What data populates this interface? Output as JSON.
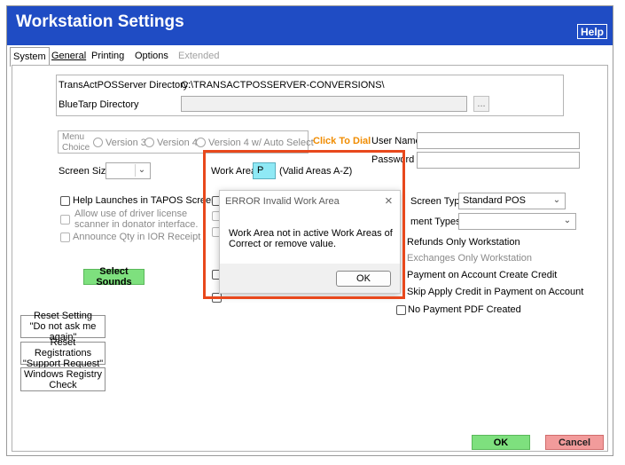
{
  "window": {
    "title": "Workstation Settings",
    "help_label": "Help"
  },
  "tabs": [
    {
      "label": "System",
      "state": "active"
    },
    {
      "label": "General",
      "state": "normal"
    },
    {
      "label": "Printing",
      "state": "normal"
    },
    {
      "label": "Options",
      "state": "normal"
    },
    {
      "label": "Extended",
      "state": "disabled"
    }
  ],
  "directories": {
    "server_label": "TransActPOSServer Directory:",
    "server_value": "C:\\TRANSACTPOSSERVER-CONVERSIONS\\",
    "bluetarp_label": "BlueTarp Directory",
    "bluetarp_value": "",
    "browse_label": "..."
  },
  "menu_choice": {
    "label_line1": "Menu",
    "label_line2": "Choice",
    "options": [
      "Version 3",
      "Version 4",
      "Version 4 w/ Auto Select"
    ]
  },
  "click_to_dial": {
    "label": "Click To Dial",
    "color": "#f08c00"
  },
  "login": {
    "user_label": "User Name",
    "user_value": "",
    "password_label": "Password",
    "password_value": ""
  },
  "screen_size": {
    "label": "Screen Size",
    "value": ""
  },
  "work_area": {
    "label": "Work Area",
    "value": "P",
    "hint": "(Valid Areas A-Z)",
    "value_bg": "#8fe9f5"
  },
  "left_checks": {
    "help_launches": "Help Launches in TAPOS Screen",
    "driver_license_line1": "Allow use of driver license",
    "driver_license_line2": "scanner in donator interface.",
    "announce_qty": "Announce Qty in IOR Receipt"
  },
  "select_sounds_label": "Select Sounds",
  "right_panel": {
    "screen_type_label": "Screen Type",
    "screen_type_value": "Standard POS",
    "payment_types_label": "ment Types",
    "payment_types_value": "",
    "refunds_only": "Refunds Only Workstation",
    "exchanges_only": "Exchanges Only Workstation",
    "payment_on_account": "Payment on Account Create Credit",
    "skip_apply_credit": "Skip Apply Credit in Payment on Account",
    "no_payment_pdf": "No Payment PDF Created"
  },
  "side_buttons": {
    "reset_setting_line1": "Reset Setting",
    "reset_setting_line2": "\"Do not ask me  again\"",
    "reset_registrations_line1": "Reset Registrations",
    "reset_registrations_line2": "\"Support Request\"",
    "windows_registry_line1": "Windows Registry",
    "windows_registry_line2": "Check"
  },
  "footer": {
    "ok_label": "OK",
    "cancel_label": "Cancel"
  },
  "error_dialog": {
    "title": "ERROR Invalid Work Area",
    "message_line1": "Work Area not in active Work Areas of",
    "message_line2": "Correct or remove value.",
    "ok_label": "OK",
    "highlight_color": "#e8481c"
  }
}
